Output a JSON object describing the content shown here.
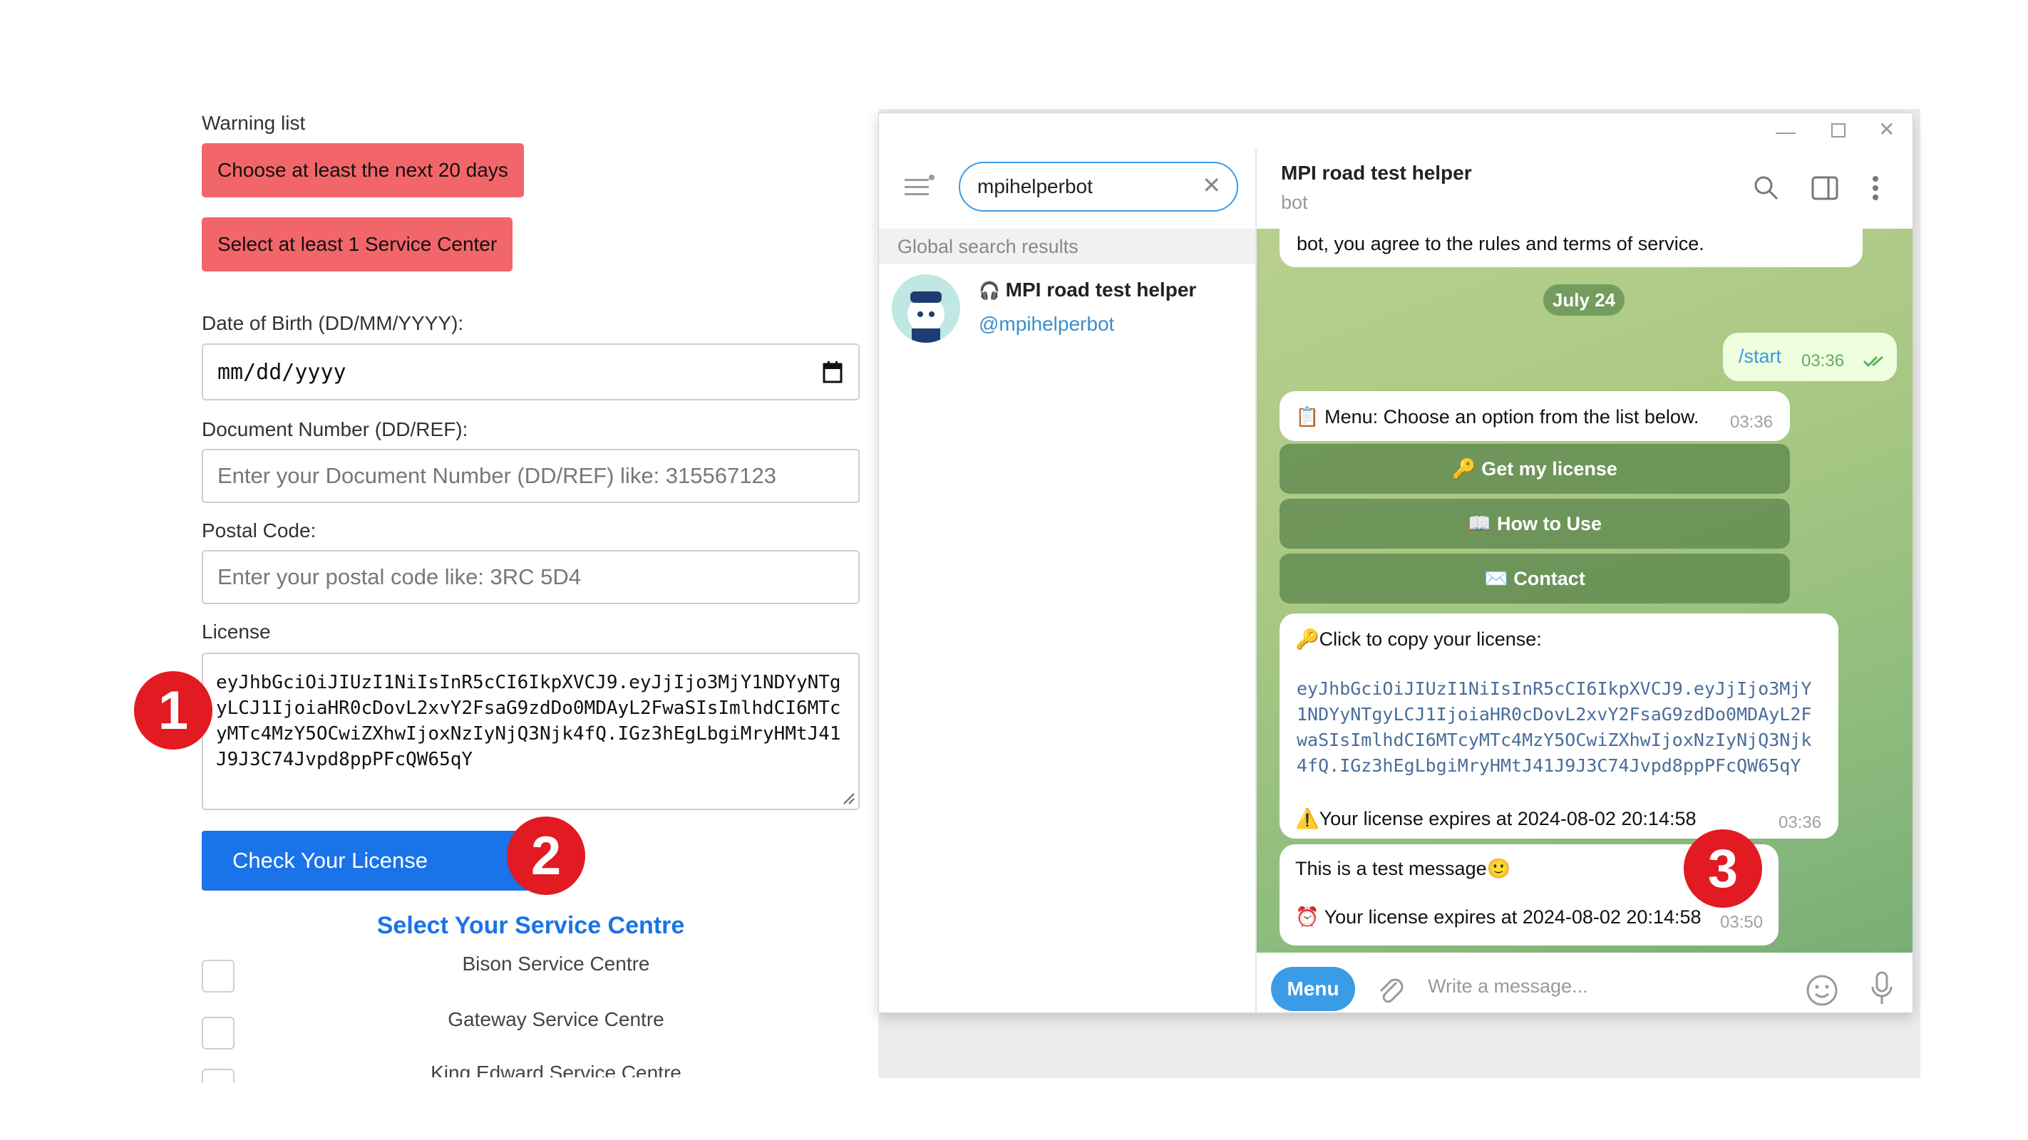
{
  "form": {
    "warning_title": "Warning list",
    "warnings": [
      "Choose at least the next 20 days",
      "Select at least 1 Service Center"
    ],
    "dob_label": "Date of Birth (DD/MM/YYYY):",
    "dob_placeholder": "mm/dd/yyyy",
    "doc_label": "Document Number (DD/REF):",
    "doc_placeholder": "Enter your Document Number (DD/REF) like: 315567123",
    "postal_label": "Postal Code:",
    "postal_placeholder": "Enter your postal code like: 3RC 5D4",
    "license_label": "License",
    "license_value": "eyJhbGciOiJIUzI1NiIsInR5cCI6IkpXVCJ9.eyJjIjo3MjY1NDYyNTgyLCJ1IjoiaHR0cDovL2xvY2FsaG9zdDo0MDAyL2FwaSIsImlhdCI6MTcyMTc4MzY5OCwiZXhwIjoxNzIyNjQ3Njk4fQ.IGz3hEgLbgiMryHMtJ41J9J3C74Jvpd8ppPFcQW65qY",
    "check_button": "Check Your License",
    "select_title": "Select Your Service Centre",
    "centres": [
      "Bison Service Centre",
      "Gateway Service Centre",
      "King Edward Service Centre"
    ]
  },
  "badges": [
    "1",
    "2",
    "3"
  ],
  "telegram": {
    "search_value": "mpihelperbot",
    "global_results_label": "Global search results",
    "result_name": "MPI road test helper",
    "result_handle": "@mpihelperbot",
    "chat_title": "MPI road test helper",
    "chat_subtitle": "bot",
    "terms_text": "bot, you agree to the rules and terms of service.",
    "date_chip": "July 24",
    "start_cmd": "/start",
    "start_time": "03:36",
    "menu_text": "📋 Menu: Choose an option from the list below.",
    "menu_time": "03:36",
    "buttons": [
      "🔑 Get my license",
      "📖 How to Use",
      "✉️ Contact"
    ],
    "copy_text": "🔑Click to copy your license:",
    "license_text": "eyJhbGciOiJIUzI1NiIsInR5cCI6IkpXVCJ9.eyJjIjo3MjY1NDYyNTgyLCJ1IjoiaHR0cDovL2xvY2FsaG9zdDo0MDAyL2FwaSIsImlhdCI6MTcyMTc4MzY5OCwiZXhwIjoxNzIyNjQ3Njk4fQ.IGz3hEgLbgiMryHMtJ41J9J3C74Jvpd8ppPFcQW65qY",
    "expire_text": "⚠️Your license expires at 2024-08-02 20:14:58",
    "license_time": "03:36",
    "test_text": "This is a test message🙂",
    "test_expire": "⏰ Your license expires at 2024-08-02 20:14:58",
    "test_time": "03:50",
    "menu_button": "Menu",
    "composer_placeholder": "Write a message..."
  },
  "colors": {
    "warning": "#f2666a",
    "primary": "#1a73e8",
    "badge": "#e21a21",
    "telegram_accent": "#3a9be6"
  }
}
